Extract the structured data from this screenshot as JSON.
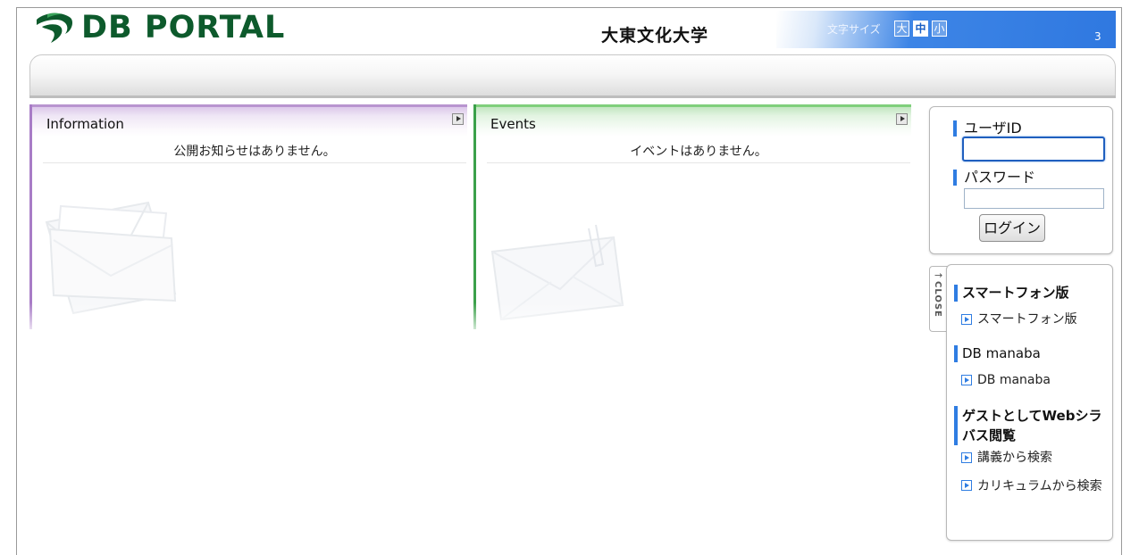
{
  "header": {
    "logo_text": "DB PORTAL",
    "university_name": "大東文化大学",
    "font_size_label": "文字サイズ",
    "font_size_options": [
      "大",
      "中",
      "小"
    ],
    "font_size_selected": "中",
    "page_counter": "3",
    "accent_blue": "#2f78e0",
    "logo_green": "#0d5a2c"
  },
  "panels": {
    "information": {
      "title": "Information",
      "empty_message": "公開お知らせはありません。",
      "accent_color": "#a87cc6"
    },
    "events": {
      "title": "Events",
      "empty_message": "イベントはありません。",
      "accent_color": "#3ba04a"
    }
  },
  "login": {
    "userid_label": "ユーザID",
    "userid_value": "",
    "password_label": "パスワード",
    "password_value": "",
    "login_button": "ログイン"
  },
  "links": {
    "close_label": "CLOSE",
    "close_arrow": "→",
    "sections": [
      {
        "title": "スマートフォン版",
        "items": [
          "スマートフォン版"
        ]
      },
      {
        "title": "DB manaba",
        "items": [
          "DB manaba"
        ]
      },
      {
        "title": "ゲストとしてWebシラバス閲覧",
        "items": [
          "講義から検索",
          "カリキュラムから検索"
        ]
      }
    ]
  }
}
